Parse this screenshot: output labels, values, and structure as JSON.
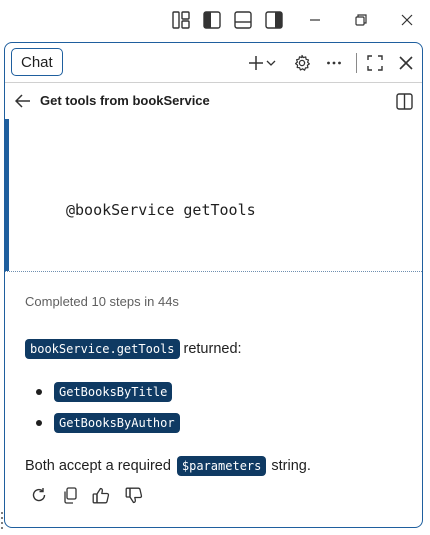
{
  "window": {
    "layout_icons": [
      "customize-layout-icon",
      "toggle-primary-sidebar-icon",
      "toggle-panel-icon",
      "toggle-secondary-sidebar-icon"
    ],
    "controls": [
      "minimize-icon",
      "restore-icon",
      "close-icon"
    ]
  },
  "chat": {
    "tab_label": "Chat",
    "header_icons": [
      "new-chat-icon",
      "chevron-down-icon",
      "settings-icon",
      "more-icon",
      "maximize-icon",
      "close-icon"
    ],
    "thread_title": "Get tools from bookService",
    "user_message": "@bookService getTools",
    "response": {
      "status": "Completed 10 steps in 44s",
      "line1_code": "bookService.getTools",
      "line1_text": "returned:",
      "tools": [
        "GetBooksByTitle",
        "GetBooksByAuthor"
      ],
      "line2_prefix": "Both accept a required",
      "line2_code": "$parameters",
      "line2_suffix": "string."
    },
    "actions": [
      "retry-icon",
      "copy-icon",
      "thumbs-up-icon",
      "thumbs-down-icon"
    ]
  },
  "colors": {
    "accent": "#1f5f9e",
    "code_bg": "#0f3a63"
  }
}
